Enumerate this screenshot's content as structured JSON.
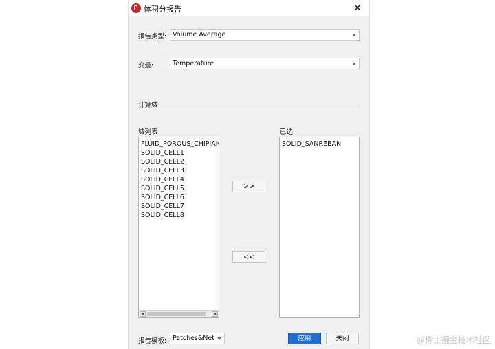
{
  "window": {
    "title": "体积分报告",
    "close_glyph": "✕"
  },
  "report_type": {
    "label": "报告类型:",
    "value": "Volume Average"
  },
  "variable": {
    "label": "变量:",
    "value": "Temperature"
  },
  "compute_domain": {
    "section_label": "计算域"
  },
  "domain_list": {
    "label": "域列表",
    "items": [
      "FLUID_POROUS_CHIPIAN",
      "SOLID_CELL1",
      "SOLID_CELL2",
      "SOLID_CELL3",
      "SOLID_CELL4",
      "SOLID_CELL5",
      "SOLID_CELL6",
      "SOLID_CELL7",
      "SOLID_CELL8"
    ]
  },
  "selected_list": {
    "label": "已选",
    "items": [
      "SOLID_SANREBAN"
    ]
  },
  "transfer": {
    "add_label": ">>",
    "remove_label": "<<"
  },
  "footer": {
    "template_label": "报告模板:",
    "template_value": "Patches&Net",
    "apply_label": "应用",
    "close_label": "关闭"
  },
  "watermark": "@稀土掘金技术社区",
  "colors": {
    "primary_button": "#1f6fd1",
    "app_icon": "#c62828"
  }
}
